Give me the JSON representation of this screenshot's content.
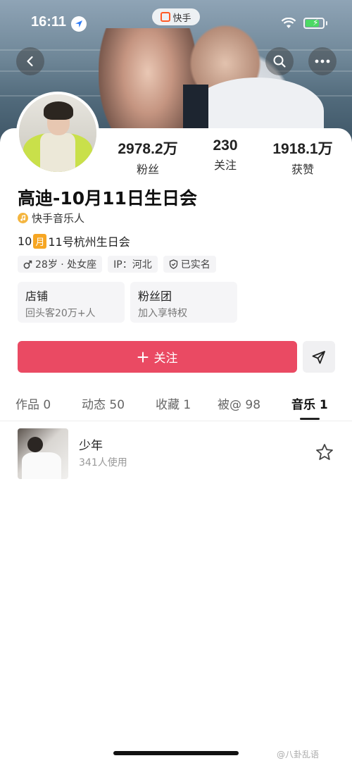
{
  "status_bar": {
    "time": "16:11",
    "app_name": "快手"
  },
  "profile": {
    "stats": [
      {
        "value": "2978.2万",
        "label": "粉丝"
      },
      {
        "value": "230",
        "label": "关注"
      },
      {
        "value": "1918.1万",
        "label": "获赞"
      }
    ],
    "name": "高迪-10月11日生日会",
    "verified_label": "快手音乐人",
    "bio_prefix": "10",
    "bio_emoji": "月",
    "bio_suffix": "11号杭州生日会",
    "tags": {
      "gender_age": "28岁 · 处女座",
      "ip": "IP：河北",
      "real_name": "已实名"
    },
    "tiles": [
      {
        "title": "店铺",
        "subtitle": "回头客20万+人"
      },
      {
        "title": "粉丝团",
        "subtitle": "加入享特权"
      }
    ],
    "follow_label": "关注"
  },
  "tabs": [
    {
      "label": "作品 0"
    },
    {
      "label": "动态 50"
    },
    {
      "label": "收藏 1"
    },
    {
      "label": "被@ 98"
    },
    {
      "label": "音乐 1"
    }
  ],
  "music": {
    "title": "少年",
    "usage": "341人使用"
  },
  "watermark": "@八卦乱语"
}
